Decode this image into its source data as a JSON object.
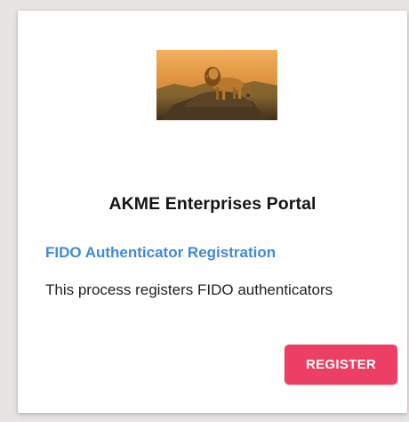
{
  "card": {
    "title": "AKME Enterprises Portal",
    "subtitle": "FIDO Authenticator Registration",
    "description": "This process registers FIDO authenticators",
    "register_label": "REGISTER",
    "hero_image": "lion-on-rock-landscape"
  },
  "colors": {
    "background": "#e9e4e4",
    "card": "#ffffff",
    "subtitle": "#3f8ad8",
    "button": "#ec3f63",
    "button_text": "#ffffff"
  }
}
